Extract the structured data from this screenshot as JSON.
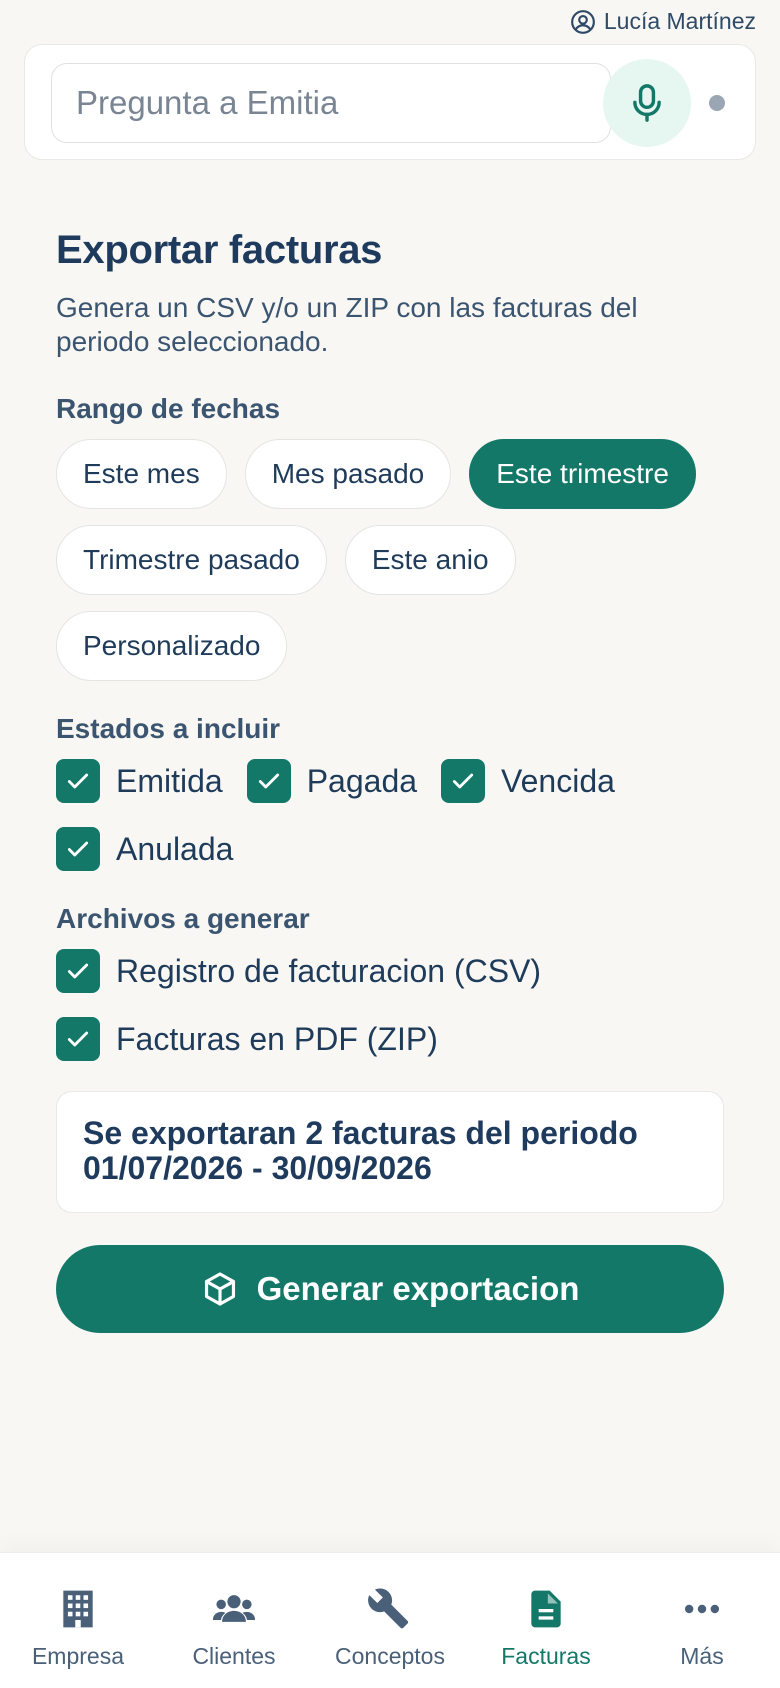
{
  "header": {
    "user_name": "Lucía Martínez",
    "user_icon": "user-circle-icon"
  },
  "ask": {
    "placeholder": "Pregunta a Emitia",
    "mic_icon": "microphone-icon"
  },
  "export": {
    "title": "Exportar facturas",
    "subtitle": "Genera un CSV y/o un ZIP con las facturas del periodo seleccionado.",
    "date_range": {
      "label": "Rango de fechas",
      "options": [
        {
          "label": "Este mes",
          "selected": false
        },
        {
          "label": "Mes pasado",
          "selected": false
        },
        {
          "label": "Este trimestre",
          "selected": true
        },
        {
          "label": "Trimestre pasado",
          "selected": false
        },
        {
          "label": "Este anio",
          "selected": false
        },
        {
          "label": "Personalizado",
          "selected": false
        }
      ]
    },
    "states": {
      "label": "Estados a incluir",
      "items": [
        {
          "label": "Emitida",
          "checked": true
        },
        {
          "label": "Pagada",
          "checked": true
        },
        {
          "label": "Vencida",
          "checked": true
        },
        {
          "label": "Anulada",
          "checked": true
        }
      ]
    },
    "files": {
      "label": "Archivos a generar",
      "items": [
        {
          "label": "Registro de facturacion (CSV)",
          "checked": true
        },
        {
          "label": "Facturas en PDF (ZIP)",
          "checked": true
        }
      ]
    },
    "summary": "Se exportaran 2 facturas del periodo 01/07/2026 - 30/09/2026",
    "button_label": "Generar exportacion",
    "button_icon": "package-icon"
  },
  "nav": {
    "items": [
      {
        "label": "Empresa",
        "icon": "building-icon",
        "active": false
      },
      {
        "label": "Clientes",
        "icon": "users-icon",
        "active": false
      },
      {
        "label": "Conceptos",
        "icon": "wrench-icon",
        "active": false
      },
      {
        "label": "Facturas",
        "icon": "document-icon",
        "active": true
      },
      {
        "label": "Más",
        "icon": "more-icon",
        "active": false
      }
    ]
  },
  "colors": {
    "accent": "#137868",
    "text": "#1f3b5a",
    "background": "#f8f7f4"
  }
}
